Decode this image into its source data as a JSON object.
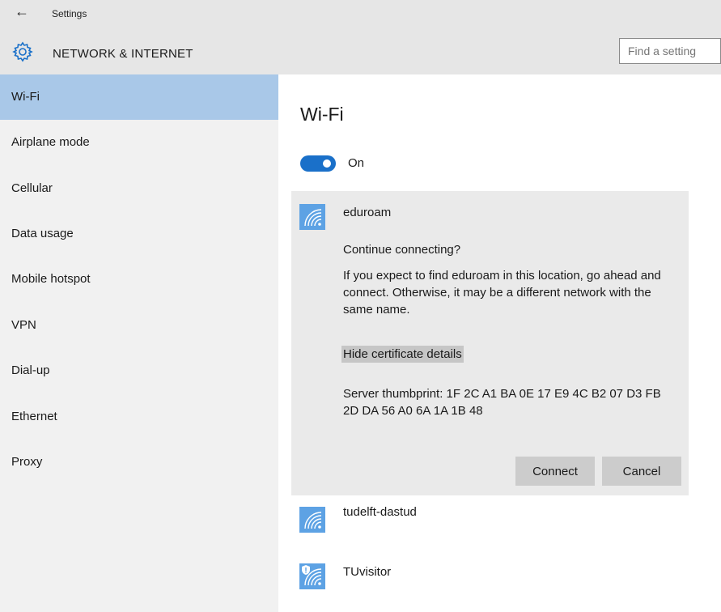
{
  "window": {
    "title": "Settings",
    "back_glyph": "←"
  },
  "header": {
    "title": "NETWORK & INTERNET",
    "icon": "gear-icon"
  },
  "search": {
    "placeholder": "Find a setting"
  },
  "sidebar": {
    "selected": "Wi-Fi",
    "items": [
      {
        "label": "Wi-Fi"
      },
      {
        "label": "Airplane mode"
      },
      {
        "label": "Cellular"
      },
      {
        "label": "Data usage"
      },
      {
        "label": "Mobile hotspot"
      },
      {
        "label": "VPN"
      },
      {
        "label": "Dial-up"
      },
      {
        "label": "Ethernet"
      },
      {
        "label": "Proxy"
      }
    ]
  },
  "main": {
    "title": "Wi-Fi",
    "toggle": {
      "state_label": "On",
      "on": true
    },
    "expanded_network": {
      "name": "eduroam",
      "prompt": "Continue connecting?",
      "explanation": "If you expect to find eduroam in this location, go ahead and connect. Otherwise, it may be a different network with the same name.",
      "cert_link": "Hide certificate details",
      "thumbprint": "Server thumbprint: 1F 2C A1 BA 0E 17 E9 4C B2 07 D3 FB 2D DA 56 A0 6A 1A 1B 48",
      "connect_label": "Connect",
      "cancel_label": "Cancel"
    },
    "networks": [
      {
        "name": "tudelft-dastud",
        "secured": false
      },
      {
        "name": "TUvisitor",
        "secured": true
      }
    ]
  },
  "colors": {
    "accent": "#1a70c9",
    "wifi_tile": "#5da2e4",
    "selected_nav": "#a9c8e8",
    "sidebar_bg": "#f1f1f1",
    "header_bg": "#e6e6e6",
    "panel_bg": "#eaeaea",
    "button_bg": "#cccccc"
  }
}
